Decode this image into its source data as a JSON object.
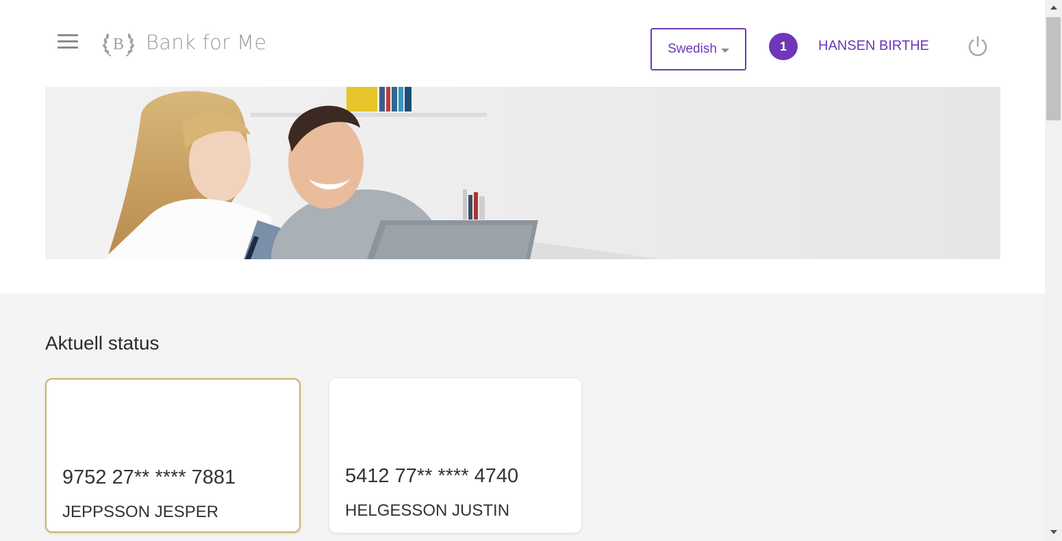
{
  "header": {
    "logo_text": "Bank for Me",
    "language": "Swedish",
    "notification_count": "1",
    "user_name": "HANSEN BIRTHE"
  },
  "icons": {
    "menu": "hamburger-menu-icon",
    "logo": "laurel-b-emblem",
    "power": "power-icon",
    "dropdown": "caret-down-icon"
  },
  "colors": {
    "accent": "#6f37b9",
    "selected_border": "#c6b36a",
    "content_bg": "#f4f4f4"
  },
  "main": {
    "section_title": "Aktuell status",
    "cards": [
      {
        "number": "9752 27** **** 7881",
        "holder": "JEPPSSON JESPER",
        "selected": true
      },
      {
        "number": "5412 77** **** 4740",
        "holder": "HELGESSON JUSTIN",
        "selected": false
      }
    ]
  }
}
